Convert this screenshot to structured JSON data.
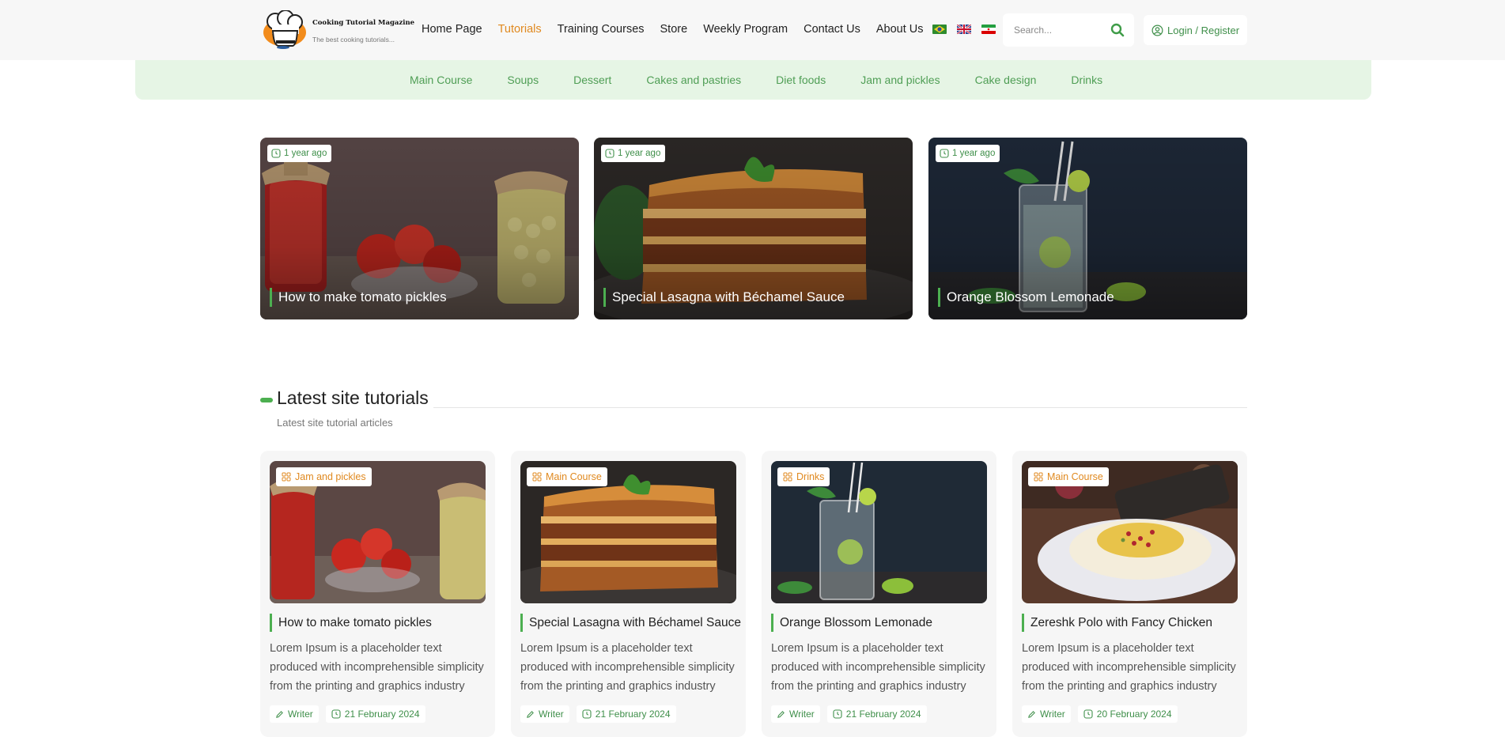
{
  "brand": {
    "title": "Cooking Tutorial Magazine",
    "tagline": "The best cooking tutorials..."
  },
  "nav": [
    {
      "label": "Home Page",
      "active": false
    },
    {
      "label": "Tutorials",
      "active": true
    },
    {
      "label": "Training Courses",
      "active": false
    },
    {
      "label": "Store",
      "active": false
    },
    {
      "label": "Weekly Program",
      "active": false
    },
    {
      "label": "Contact Us",
      "active": false
    },
    {
      "label": "About Us",
      "active": false
    }
  ],
  "languages": [
    "flag-brazil",
    "flag-uk",
    "flag-iran"
  ],
  "search": {
    "placeholder": "Search...",
    "icon": "search-icon"
  },
  "login": {
    "label": "Login / Register",
    "icon": "user-circle-icon"
  },
  "categories": [
    "Main Course",
    "Soups",
    "Dessert",
    "Cakes and pastries",
    "Diet foods",
    "Jam and pickles",
    "Cake design",
    "Drinks"
  ],
  "featured": [
    {
      "time": "1 year ago",
      "title": "How to make tomato pickles"
    },
    {
      "time": "1 year ago",
      "title": "Special Lasagna with Béchamel Sauce"
    },
    {
      "time": "1 year ago",
      "title": "Orange Blossom Lemonade"
    }
  ],
  "section": {
    "title": "Latest site tutorials",
    "subtitle": "Latest site tutorial articles"
  },
  "tutorials": [
    {
      "category": "Jam and pickles",
      "title": "How to make tomato pickles",
      "description": "Lorem Ipsum is a placeholder text produced with incomprehensible simplicity from the printing and graphics industry",
      "author": "Writer",
      "date": "21 February 2024"
    },
    {
      "category": "Main Course",
      "title": "Special Lasagna with Béchamel Sauce",
      "description": "Lorem Ipsum is a placeholder text produced with incomprehensible simplicity from the printing and graphics industry",
      "author": "Writer",
      "date": "21 February 2024"
    },
    {
      "category": "Drinks",
      "title": "Orange Blossom Lemonade",
      "description": "Lorem Ipsum is a placeholder text produced with incomprehensible simplicity from the printing and graphics industry",
      "author": "Writer",
      "date": "21 February 2024"
    },
    {
      "category": "Main Course",
      "title": "Zereshk Polo with Fancy Chicken",
      "description": "Lorem Ipsum is a placeholder text produced with incomprehensible simplicity from the printing and graphics industry",
      "author": "Writer",
      "date": "20 February 2024"
    }
  ],
  "colors": {
    "accent_green": "#4caf50",
    "link_green": "#3f8f4a",
    "active_orange": "#e0891f",
    "category_bar_bg": "#e6f5e5"
  }
}
